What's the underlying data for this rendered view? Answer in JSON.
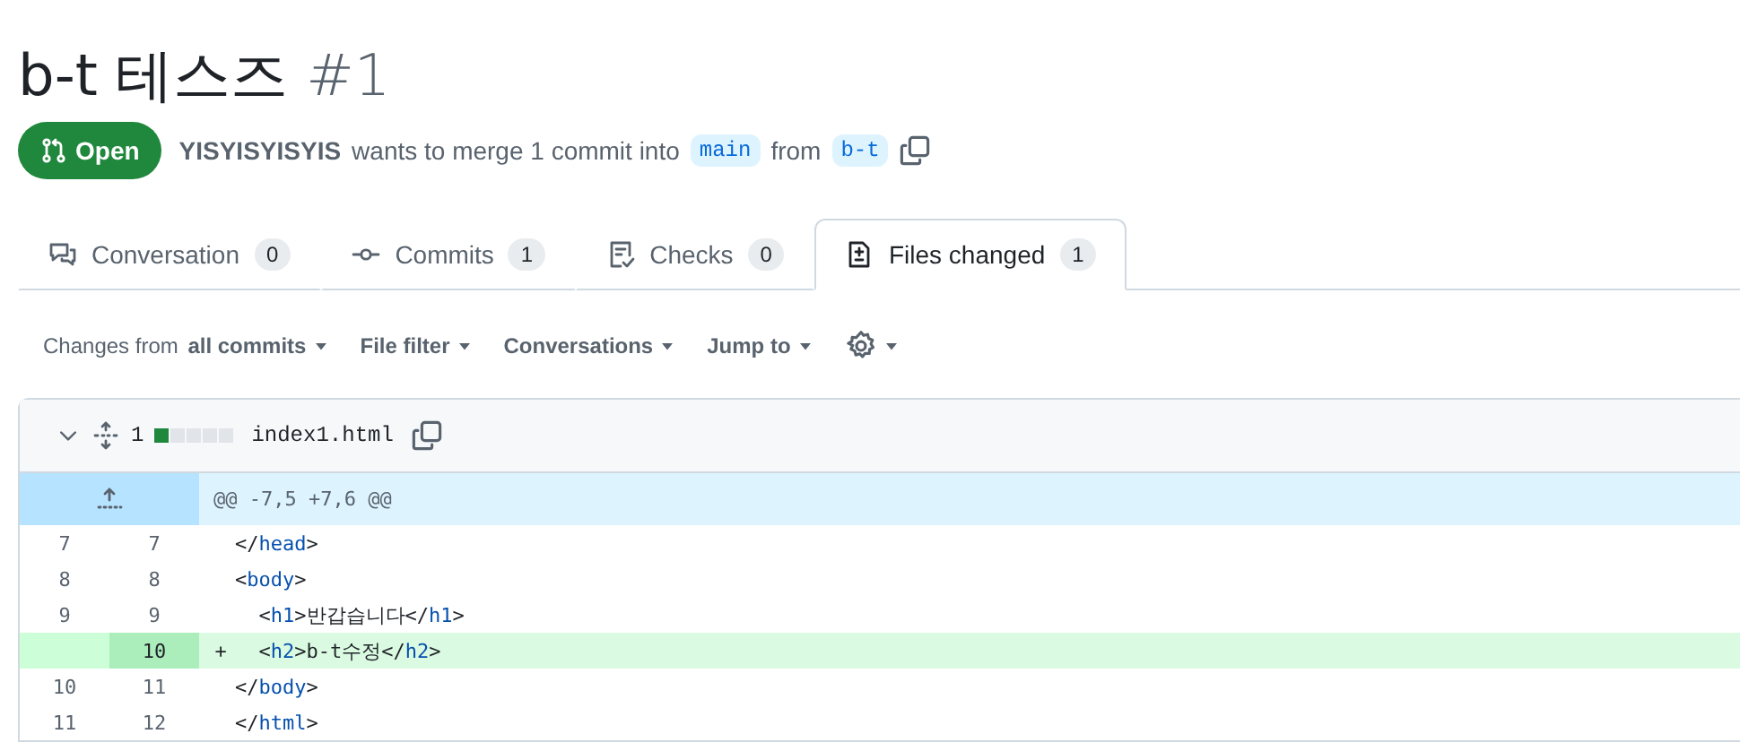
{
  "title": "b-t 테스즈",
  "number": "#1",
  "status": {
    "label": "Open",
    "kind": "open"
  },
  "merge_info": {
    "author": "YISYISYISYIS",
    "text_1": "wants to merge 1 commit into",
    "base": "main",
    "text_2": "from",
    "head": "b-t"
  },
  "tabs": [
    {
      "label": "Conversation",
      "count": "0",
      "kind": "comment",
      "selected": false
    },
    {
      "label": "Commits",
      "count": "1",
      "kind": "commit",
      "selected": false
    },
    {
      "label": "Checks",
      "count": "0",
      "kind": "checks",
      "selected": false
    },
    {
      "label": "Files changed",
      "count": "1",
      "kind": "diff",
      "selected": true
    }
  ],
  "toolbar": [
    {
      "kind": "text",
      "prefix": "Changes from",
      "label": "all commits"
    },
    {
      "kind": "text",
      "label": "File filter"
    },
    {
      "kind": "text",
      "label": "Conversations"
    },
    {
      "kind": "text",
      "label": "Jump to"
    },
    {
      "kind": "gear"
    }
  ],
  "file": {
    "expanded": true,
    "changes": "1",
    "diffstat": [
      {
        "kind": "added"
      },
      {
        "kind": "neutral"
      },
      {
        "kind": "neutral"
      },
      {
        "kind": "neutral"
      },
      {
        "kind": "neutral"
      }
    ],
    "name": "index1.html",
    "hunk": "@@ -7,5 +7,6 @@",
    "lines": [
      {
        "kind": "context",
        "old": "7",
        "new": "7",
        "code": "</head>"
      },
      {
        "kind": "context",
        "old": "8",
        "new": "8",
        "code": "<body>"
      },
      {
        "kind": "context",
        "old": "9",
        "new": "9",
        "code": "  <h1>반갑습니다</h1>"
      },
      {
        "kind": "added",
        "new": "10",
        "sign": "+",
        "code": "  <h2>b-t수정</h2>"
      },
      {
        "kind": "context",
        "old": "10",
        "new": "11",
        "code": "</body>"
      },
      {
        "kind": "context",
        "old": "11",
        "new": "12",
        "code": "</html>"
      }
    ]
  }
}
